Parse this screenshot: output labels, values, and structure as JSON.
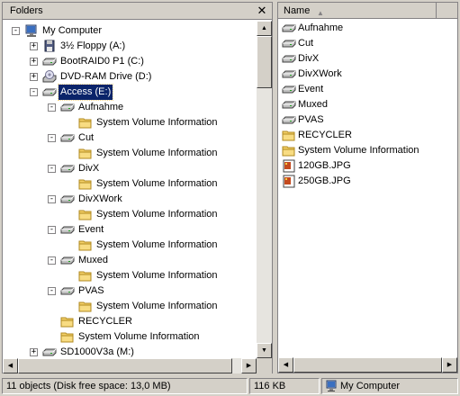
{
  "folders_pane": {
    "title": "Folders",
    "close_glyph": "✕",
    "tree": [
      {
        "label": "My Computer",
        "icon": "computer-icon",
        "expander": "−",
        "level": 0
      },
      {
        "label": "3½ Floppy (A:)",
        "icon": "floppy-icon",
        "expander": "+",
        "level": 1
      },
      {
        "label": "BootRAID0 P1 (C:)",
        "icon": "drive-icon",
        "expander": "+",
        "level": 1
      },
      {
        "label": "DVD-RAM Drive (D:)",
        "icon": "cd-drive-icon",
        "expander": "+",
        "level": 1
      },
      {
        "label": "Access (E:)",
        "icon": "drive-icon",
        "expander": "−",
        "level": 1,
        "selected": true
      },
      {
        "label": "Aufnahme",
        "icon": "drive-icon",
        "expander": "−",
        "level": 2
      },
      {
        "label": "System Volume Information",
        "icon": "folder-icon",
        "level": 3
      },
      {
        "label": "Cut",
        "icon": "drive-icon",
        "expander": "−",
        "level": 2
      },
      {
        "label": "System Volume Information",
        "icon": "folder-icon",
        "level": 3
      },
      {
        "label": "DivX",
        "icon": "drive-icon",
        "expander": "−",
        "level": 2
      },
      {
        "label": "System Volume Information",
        "icon": "folder-icon",
        "level": 3
      },
      {
        "label": "DivXWork",
        "icon": "drive-icon",
        "expander": "−",
        "level": 2
      },
      {
        "label": "System Volume Information",
        "icon": "folder-icon",
        "level": 3
      },
      {
        "label": "Event",
        "icon": "drive-icon",
        "expander": "−",
        "level": 2
      },
      {
        "label": "System Volume Information",
        "icon": "folder-icon",
        "level": 3
      },
      {
        "label": "Muxed",
        "icon": "drive-icon",
        "expander": "−",
        "level": 2
      },
      {
        "label": "System Volume Information",
        "icon": "folder-icon",
        "level": 3
      },
      {
        "label": "PVAS",
        "icon": "drive-icon",
        "expander": "−",
        "level": 2
      },
      {
        "label": "System Volume Information",
        "icon": "folder-icon",
        "level": 3
      },
      {
        "label": "RECYCLER",
        "icon": "folder-icon",
        "level": 2
      },
      {
        "label": "System Volume Information",
        "icon": "folder-icon",
        "level": 2
      },
      {
        "label": "SD1000V3a (M:)",
        "icon": "drive-icon",
        "expander": "+",
        "level": 1
      }
    ]
  },
  "contents_pane": {
    "column_name": "Name",
    "items": [
      {
        "label": "Aufnahme",
        "icon": "drive-icon"
      },
      {
        "label": "Cut",
        "icon": "drive-icon"
      },
      {
        "label": "DivX",
        "icon": "drive-icon"
      },
      {
        "label": "DivXWork",
        "icon": "drive-icon"
      },
      {
        "label": "Event",
        "icon": "drive-icon"
      },
      {
        "label": "Muxed",
        "icon": "drive-icon"
      },
      {
        "label": "PVAS",
        "icon": "drive-icon"
      },
      {
        "label": "RECYCLER",
        "icon": "folder-icon"
      },
      {
        "label": "System Volume Information",
        "icon": "folder-icon"
      },
      {
        "label": "120GB.JPG",
        "icon": "jpg-file-icon"
      },
      {
        "label": "250GB.JPG",
        "icon": "jpg-file-icon"
      }
    ]
  },
  "statusbar": {
    "objects": "11 objects (Disk free space: 13,0 MB)",
    "size": "116 KB",
    "location": "My Computer"
  },
  "colors": {
    "selection": "#0a246a",
    "chrome": "#d4d0c8",
    "folder_yellow": "#f4d068"
  }
}
